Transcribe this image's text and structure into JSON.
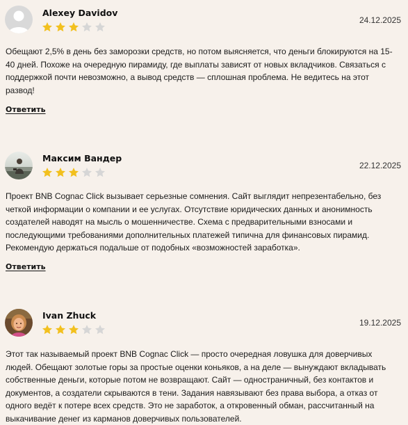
{
  "colors": {
    "background": "#f7f1eb",
    "star_filled": "#f2c01e",
    "star_empty": "#d6d6d6"
  },
  "reviews": [
    {
      "author": "Alexey Davidov",
      "date": "24.12.2025",
      "rating": 3,
      "max_rating": 5,
      "avatar": "default-avatar-icon",
      "text": "Обещают 2,5% в день без заморозки средств, но потом выясняется, что деньги блокируются на 15-40 дней. Похоже на очередную пирамиду, где выплаты зависят от новых вкладчиков. Связаться с поддержкой почти невозможно, а вывод средств — сплошная проблема. Не ведитесь на этот развод!",
      "reply_label": "Ответить"
    },
    {
      "author": "Максим Вандер",
      "date": "22.12.2025",
      "rating": 3,
      "max_rating": 5,
      "avatar": "photo-avatar",
      "text": "Проект BNB Cognac Click вызывает серьезные сомнения. Сайт выглядит непрезентабельно, без четкой информации о компании и ее услугах. Отсутствие юридических данных и анонимность создателей наводят на мысль о мошенничестве. Схема с предварительными взносами и последующими требованиями дополнительных платежей типична для финансовых пирамид. Рекомендую держаться подальше от подобных «возможностей заработка».",
      "reply_label": "Ответить"
    },
    {
      "author": "Ivan Zhuck",
      "date": "19.12.2025",
      "rating": 3,
      "max_rating": 5,
      "avatar": "photo-avatar",
      "text": "Этот так называемый проект BNB Cognac Click — просто очередная ловушка для доверчивых людей. Обещают золотые горы за простые оценки коньяков, а на деле — вынуждают вкладывать собственные деньги, которые потом не возвращают. Сайт — одностраничный, без контактов и документов, а создатели скрываются в тени. Задания навязывают без права выбора, а отказ от одного ведёт к потере всех средств. Это не заработок, а откровенный обман, рассчитанный на выкачивание денег из карманов доверчивых пользователей.",
      "reply_label": ""
    }
  ]
}
